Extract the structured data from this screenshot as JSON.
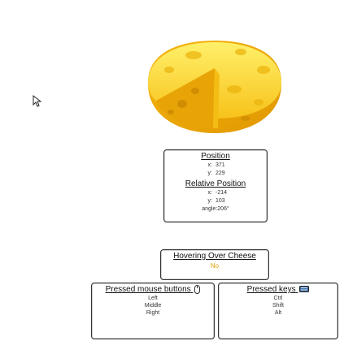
{
  "position": {
    "title": "Position",
    "x_label": "x:",
    "x_value": "371",
    "y_label": "y:",
    "y_value": "229"
  },
  "relative_position": {
    "title": "Relative Position",
    "x_label": "x:",
    "x_value": "-214",
    "y_label": "y:",
    "y_value": "103",
    "angle": "angle:206°"
  },
  "hovering": {
    "title": "Hovering Over Cheese",
    "value": "No"
  },
  "mouse_buttons": {
    "title": "Pressed mouse buttons",
    "icon": "mouse-icon",
    "items": [
      "Left",
      "Middle",
      "Right"
    ]
  },
  "keys": {
    "title": "Pressed keys",
    "icon": "keyboard-icon",
    "items": [
      "Ctrl",
      "Shift",
      "Alt"
    ]
  },
  "colors": {
    "accent": "#e0a100",
    "cheese": "#f7c21a"
  }
}
